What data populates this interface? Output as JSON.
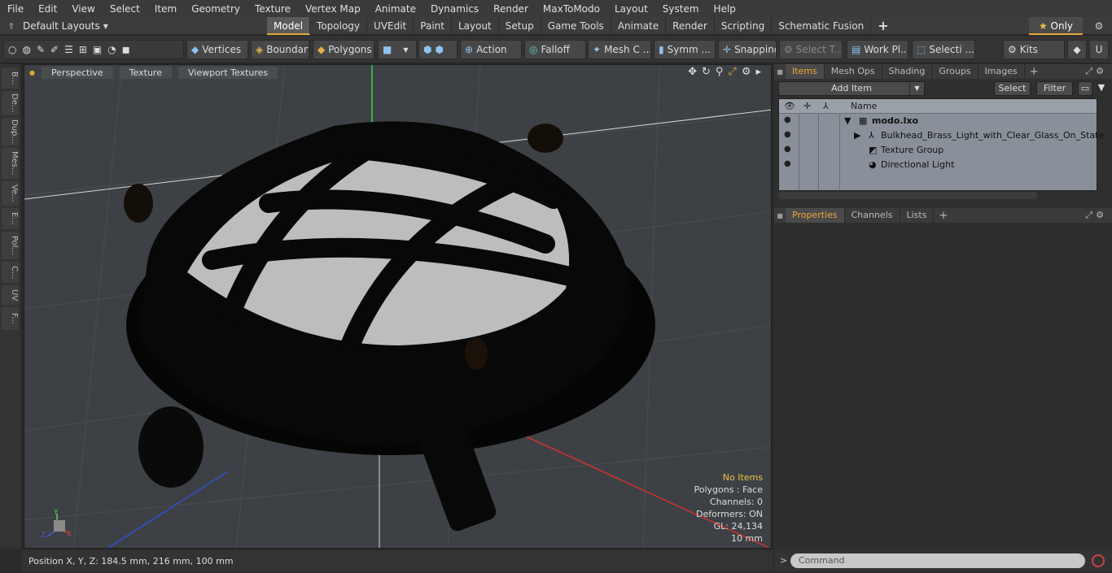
{
  "menu": [
    "File",
    "Edit",
    "View",
    "Select",
    "Item",
    "Geometry",
    "Texture",
    "Vertex Map",
    "Animate",
    "Dynamics",
    "Render",
    "MaxToModo",
    "Layout",
    "System",
    "Help"
  ],
  "layouts": {
    "label": "Default Layouts"
  },
  "mode_tabs": [
    "Model",
    "Topology",
    "UVEdit",
    "Paint",
    "Layout",
    "Setup",
    "Game Tools",
    "Animate",
    "Render",
    "Scripting",
    "Schematic Fusion"
  ],
  "only_label": "Only",
  "toolbar": {
    "vertices": "Vertices",
    "boundary": "Boundary",
    "polygons": "Polygons",
    "action": "Action",
    "falloff": "Falloff",
    "mesh_c": "Mesh C ...",
    "symm": "Symm ...",
    "snapping": "Snapping",
    "select_t": "Select T...",
    "work_pl": "Work Pl...",
    "selecti": "Selecti ...",
    "kits": "Kits"
  },
  "left_tabs": [
    "B...",
    "De...",
    "Dup...",
    "Mes...",
    "Ve...",
    "E...",
    "Pol...",
    "C...",
    "UV",
    "F..."
  ],
  "viewport": {
    "perspective": "Perspective",
    "texture": "Texture",
    "viewport_textures": "Viewport Textures",
    "stats": {
      "no_items": "No Items",
      "polygons": "Polygons : Face",
      "channels": "Channels: 0",
      "deformers": "Deformers: ON",
      "gl": "GL: 24,134",
      "scale": "10 mm"
    }
  },
  "status": {
    "position": "Position X, Y, Z:   184.5 mm, 216 mm, 100 mm"
  },
  "items_panel": {
    "tabs": [
      "Items",
      "Mesh Ops",
      "Shading",
      "Groups",
      "Images"
    ],
    "add_item": "Add Item",
    "select": "Select",
    "filter": "Filter",
    "name_header": "Name",
    "rows": [
      "modo.lxo",
      "Bulkhead_Brass_Light_with_Clear_Glass_On_State",
      "Texture Group",
      "Directional Light"
    ]
  },
  "props_panel": {
    "tabs": [
      "Properties",
      "Channels",
      "Lists"
    ]
  },
  "command": {
    "placeholder": "Command"
  },
  "colors": {
    "accent": "#e8a33b",
    "viewport_bg": "#3d4145",
    "panel_bg": "#2f2f2f"
  }
}
